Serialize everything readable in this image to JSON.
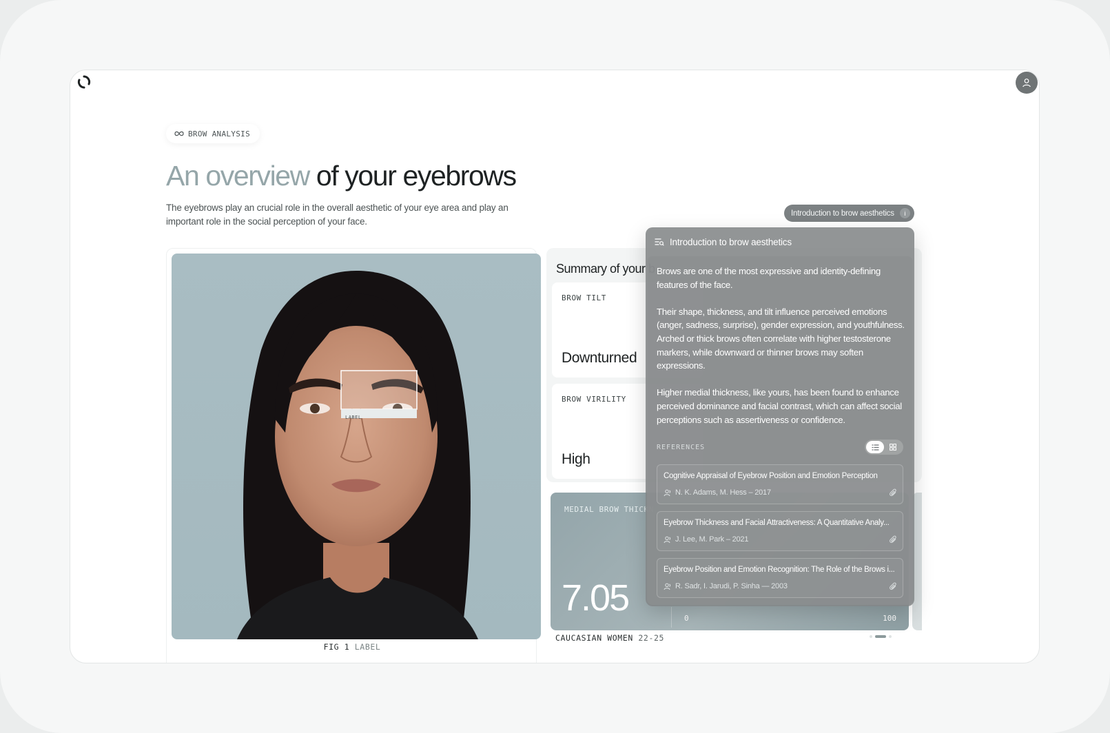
{
  "app": {
    "badge_label": "BROW ANALYSIS",
    "title_accent": "An overview",
    "title_rest": " of your eyebrows",
    "subtitle": "The eyebrows play an crucial role in the overall aesthetic of your eye area and play an important role in the social perception of your face."
  },
  "figure": {
    "fig_number": "FIG 1",
    "fig_label": "LABEL",
    "box_label": "LABEL"
  },
  "summary": {
    "title": "Summary of your b",
    "metrics": [
      {
        "label": "BROW TILT",
        "value": "Downturned"
      },
      {
        "label": "BROW VIRILITY",
        "value": "High"
      }
    ],
    "thickness": {
      "label": "MEDIAL BROW THICKN",
      "value": "7.05",
      "scale_min": "0",
      "scale_max": "100"
    },
    "population_main": "CAUCASIAN WOMEN",
    "population_range": "22-25"
  },
  "info_chip": {
    "label": "Introduction to brow aesthetics",
    "icon": "i"
  },
  "overlay": {
    "title": "Introduction to brow aesthetics",
    "paragraphs": [
      "Brows are one of the most expressive and identity-defining features of the face.",
      "Their shape, thickness, and tilt influence perceived emotions (anger, sadness, surprise), gender expression, and youthfulness. Arched or thick brows often correlate with higher testosterone markers, while downward or thinner brows may soften expressions.",
      "Higher medial thickness, like yours, has been found to enhance perceived dominance and facial contrast, which can affect social perceptions such as assertiveness or confidence."
    ],
    "references_label": "REFERENCES",
    "references": [
      {
        "title": "Cognitive Appraisal of Eyebrow Position and Emotion Perception",
        "authors": "N. K. Adams, M. Hess – 2017"
      },
      {
        "title": "Eyebrow Thickness and Facial Attractiveness: A Quantitative Analy...",
        "authors": "J. Lee, M. Park – 2021"
      },
      {
        "title": "Eyebrow Position and Emotion Recognition: The Role of the Brows i...",
        "authors": "R. Sadr, I. Jarudi, P. Sinha — 2003"
      }
    ]
  },
  "colors": {
    "accent_title": "#95a6a9",
    "photo_background": "#a9bdc3",
    "overlay": "#808485"
  }
}
